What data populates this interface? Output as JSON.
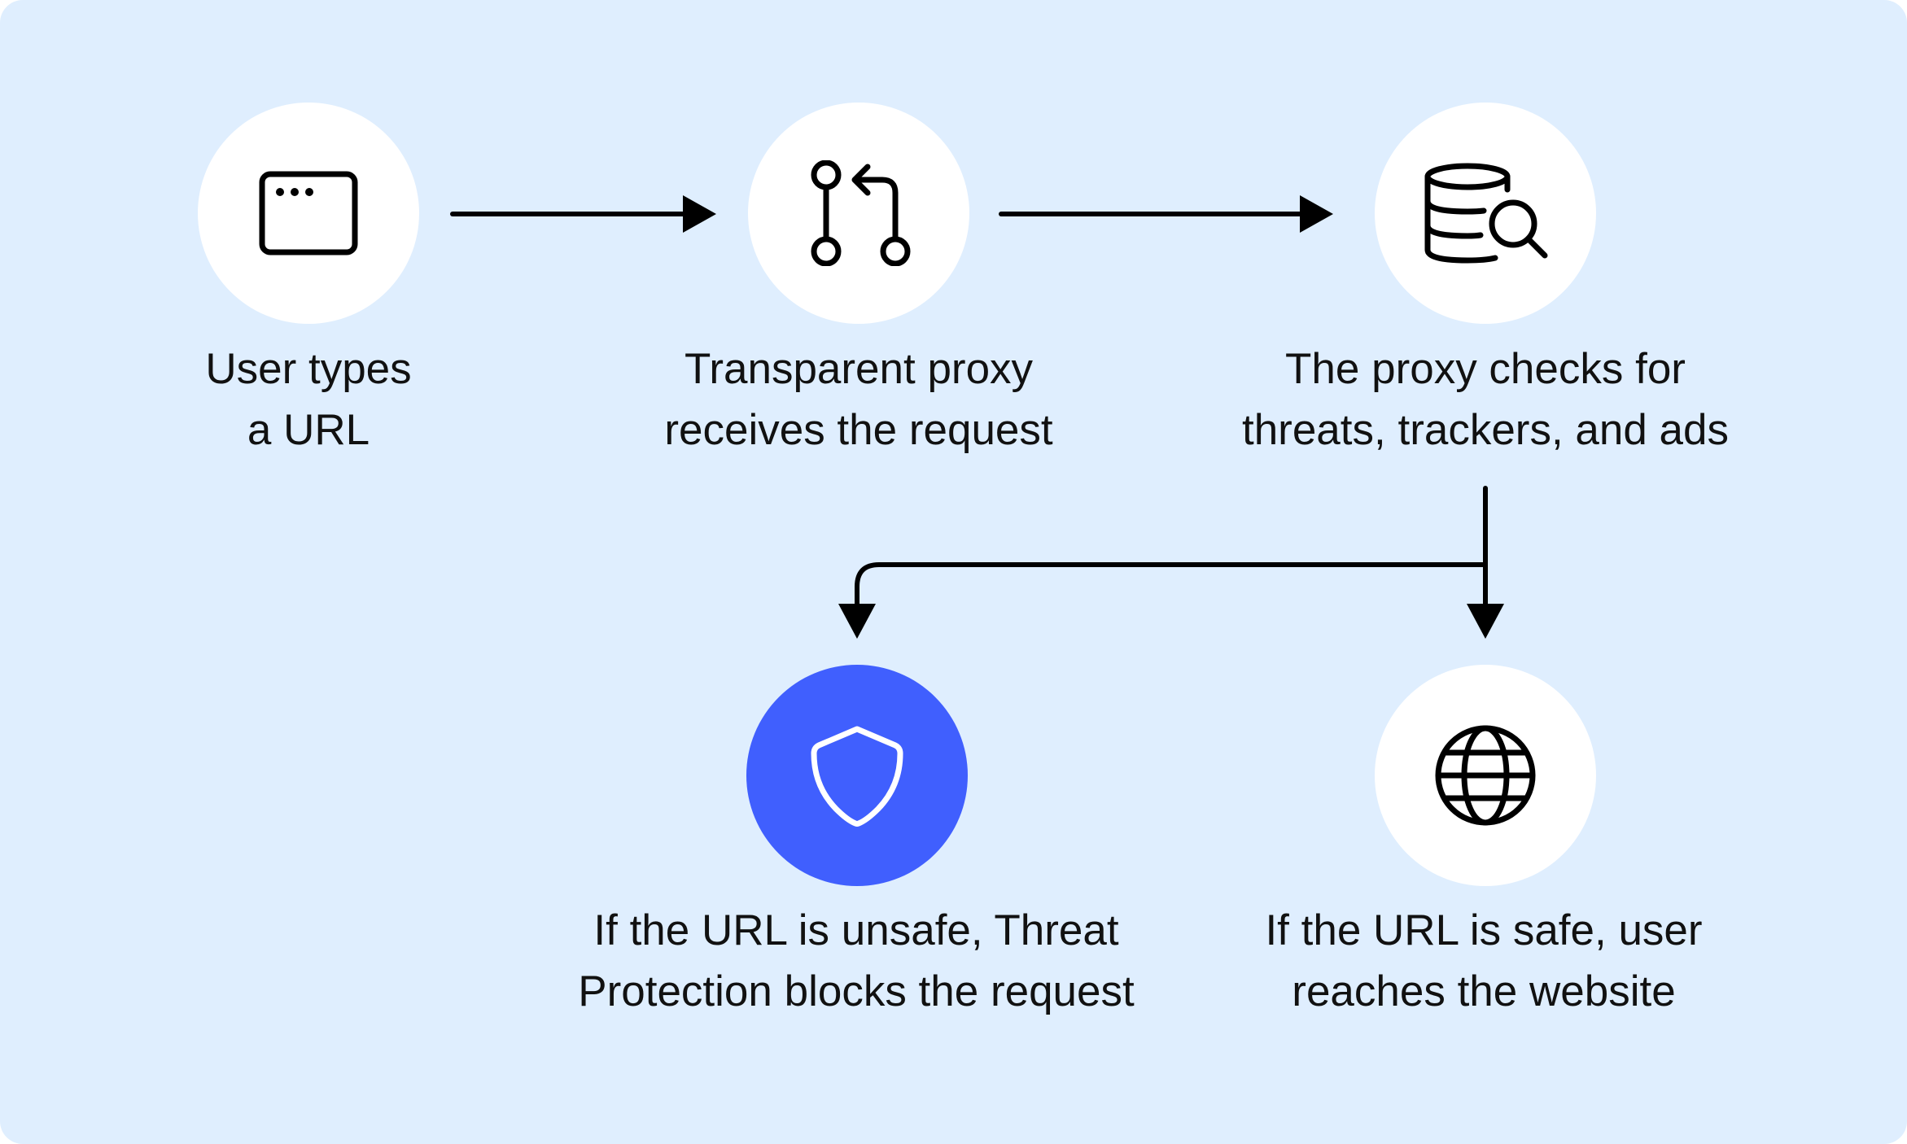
{
  "colors": {
    "background": "#dfeefe",
    "node": "#ffffff",
    "node_accent": "#405ffe",
    "line": "#000000",
    "text": "#111111"
  },
  "steps": [
    {
      "id": "user-types-url",
      "icon": "browser-window-icon",
      "label_lines": [
        "User types",
        "a URL"
      ]
    },
    {
      "id": "transparent-proxy",
      "icon": "pull-request-icon",
      "label_lines": [
        "Transparent proxy",
        "receives the request"
      ]
    },
    {
      "id": "proxy-checks",
      "icon": "database-search-icon",
      "label_lines": [
        "The proxy checks for",
        "threats, trackers, and ads"
      ]
    },
    {
      "id": "threat-protection-blocks",
      "icon": "shield-icon",
      "highlighted": true,
      "label_lines": [
        "If the URL is unsafe, Threat",
        "Protection blocks the request"
      ]
    },
    {
      "id": "user-reaches-website",
      "icon": "globe-icon",
      "label_lines": [
        "If the URL is safe, user",
        "reaches the website"
      ]
    }
  ]
}
